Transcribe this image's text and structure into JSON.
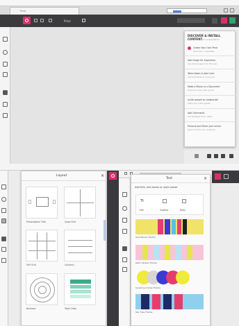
{
  "top": {
    "browser_tab": "Prezi",
    "address_text": "prezi.com",
    "app_title": "Prezi",
    "panel": {
      "title": "DISCOVER & INSTALL CONTENT",
      "subtitle": "Add more to your presentation",
      "items": [
        {
          "label": "Create Your Own Prezi",
          "sub": "Start from a template"
        },
        {
          "label": "Add Image for Inspiration",
          "sub": "Use free images from the web"
        },
        {
          "label": "Write Notes & Add Links",
          "sub": "Add text boxes to your prezi"
        },
        {
          "label": "Make a Movie or a Document",
          "sub": "Drag and drop a file to add"
        },
        {
          "label": "Invite people to collaborate",
          "sub": "Share and edit together"
        },
        {
          "label": "Add Comments",
          "sub": "Get feedback from others"
        },
        {
          "label": "Present and Share your online",
          "sub": "Send a link to your audience"
        }
      ]
    }
  },
  "bottom": {
    "layout_panel": {
      "title": "Layout",
      "close": "×",
      "thumbs": [
        {
          "label": "Presentation Title"
        },
        {
          "label": "Quad Grid"
        },
        {
          "label": "9x9 Grid"
        },
        {
          "label": "Columns"
        },
        {
          "label": "Bullseye"
        },
        {
          "label": "Table Data"
        }
      ]
    },
    "text_panel": {
      "title": "Text",
      "close": "×",
      "heading": "Add title, text boxes or style preset",
      "styles": [
        "Title",
        "Subtitle",
        "Body"
      ],
      "palettes": [
        {
          "label": "Gold Blocks Theme"
        },
        {
          "label": "Retro Stripes Theme"
        },
        {
          "label": "Sunshine Circles Theme"
        },
        {
          "label": "Sky Tiles Theme"
        }
      ]
    }
  },
  "colors": {
    "accent": "#d8316a",
    "dark_bar": "#3b3b3d"
  }
}
